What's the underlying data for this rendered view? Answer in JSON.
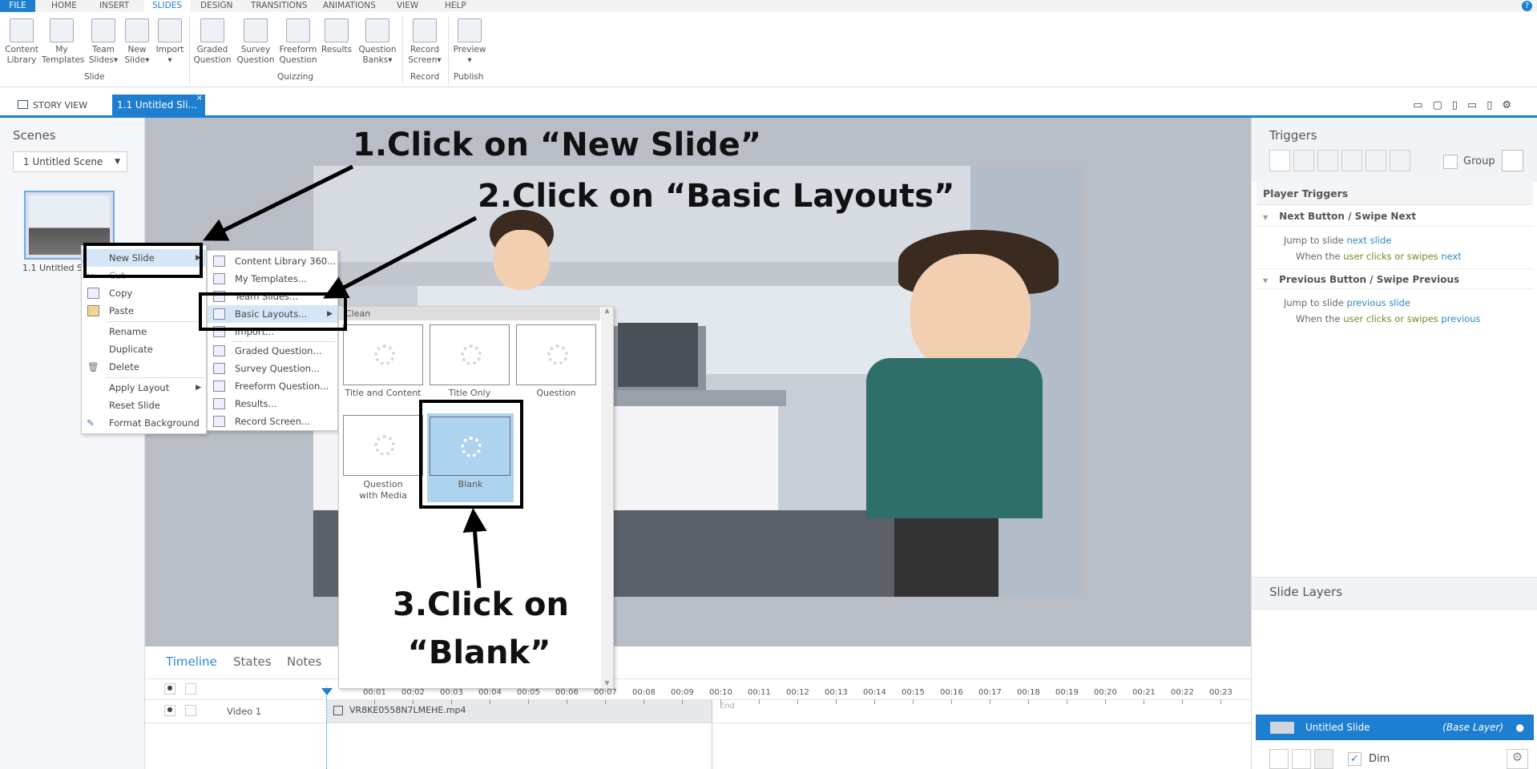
{
  "menu_tabs": [
    "FILE",
    "HOME",
    "INSERT",
    "SLIDES",
    "DESIGN",
    "TRANSITIONS",
    "ANIMATIONS",
    "VIEW",
    "HELP"
  ],
  "active_tab": "SLIDES",
  "ribbon": {
    "buttons": [
      {
        "l1": "Content",
        "l2": "Library"
      },
      {
        "l1": "My",
        "l2": "Templates"
      },
      {
        "l1": "Team",
        "l2": "Slides▾"
      },
      {
        "l1": "New",
        "l2": "Slide▾"
      },
      {
        "l1": "Import",
        "l2": "▾"
      },
      {
        "l1": "Graded",
        "l2": "Question"
      },
      {
        "l1": "Survey",
        "l2": "Question"
      },
      {
        "l1": "Freeform",
        "l2": "Question"
      },
      {
        "l1": "Results",
        "l2": ""
      },
      {
        "l1": "Question",
        "l2": "Banks▾"
      },
      {
        "l1": "Record",
        "l2": "Screen▾"
      },
      {
        "l1": "Preview",
        "l2": "▾"
      }
    ],
    "groups": [
      "Slide",
      "Quizzing",
      "Record",
      "Publish"
    ]
  },
  "tabs": {
    "story_view": "STORY VIEW",
    "slide_tab": "1.1 Untitled Sli..."
  },
  "scenes": {
    "title": "Scenes",
    "dropdown": "1 Untitled Scene",
    "slide_label": "1.1 Untitled Sli"
  },
  "context_menu": {
    "items": [
      "New Slide",
      "Cut",
      "Copy",
      "Paste",
      "Rename",
      "Duplicate",
      "Delete",
      "Apply Layout",
      "Reset Slide",
      "Format Background"
    ]
  },
  "submenu": {
    "items": [
      "Content Library 360...",
      "My Templates...",
      "Team Slides...",
      "Basic Layouts...",
      "Import...",
      "Graded Question...",
      "Survey Question...",
      "Freeform Question...",
      "Results...",
      "Record Screen..."
    ]
  },
  "gallery": {
    "header": "Clean",
    "layouts": [
      "Title and Content",
      "Title Only",
      "Question",
      "Question with Media",
      "Blank"
    ],
    "selected": "Blank"
  },
  "annotations": {
    "step1": "1.Click on “New Slide”",
    "step2": "2.Click on “Basic Layouts”",
    "step3a": "3.Click on",
    "step3b": "“Blank”"
  },
  "triggers": {
    "title": "Triggers",
    "group_label": "Group",
    "player_triggers": "Player Triggers",
    "next": {
      "heading": "Next Button / Swipe Next",
      "action": "Jump to slide",
      "target": "next slide",
      "when": "When the",
      "who": "user clicks or swipes",
      "dir": "next"
    },
    "prev": {
      "heading": "Previous Button / Swipe Previous",
      "action": "Jump to slide",
      "target": "previous slide",
      "when": "When the",
      "who": "user clicks or swipes",
      "dir": "previous"
    }
  },
  "layers": {
    "title": "Slide Layers",
    "layer_name": "Untitled Slide",
    "layer_tag": "(Base Layer)",
    "dim": "Dim",
    "dim_checked": true
  },
  "timeline": {
    "tabs": [
      "Timeline",
      "States",
      "Notes"
    ],
    "track": "Video 1",
    "clip": "VR8KE0558N7LMEHE.mp4",
    "end": "End",
    "ticks": [
      "00:01",
      "00:02",
      "00:03",
      "00:04",
      "00:05",
      "00:06",
      "00:07",
      "00:08",
      "00:09",
      "00:10",
      "00:11",
      "00:12",
      "00:13",
      "00:14",
      "00:15",
      "00:16",
      "00:17",
      "00:18",
      "00:19",
      "00:20",
      "00:21",
      "00:22",
      "00:23"
    ]
  },
  "colors": {
    "accent": "#1e7fd0",
    "link": "#2a8bbd",
    "user_text": "#6b8e23"
  }
}
